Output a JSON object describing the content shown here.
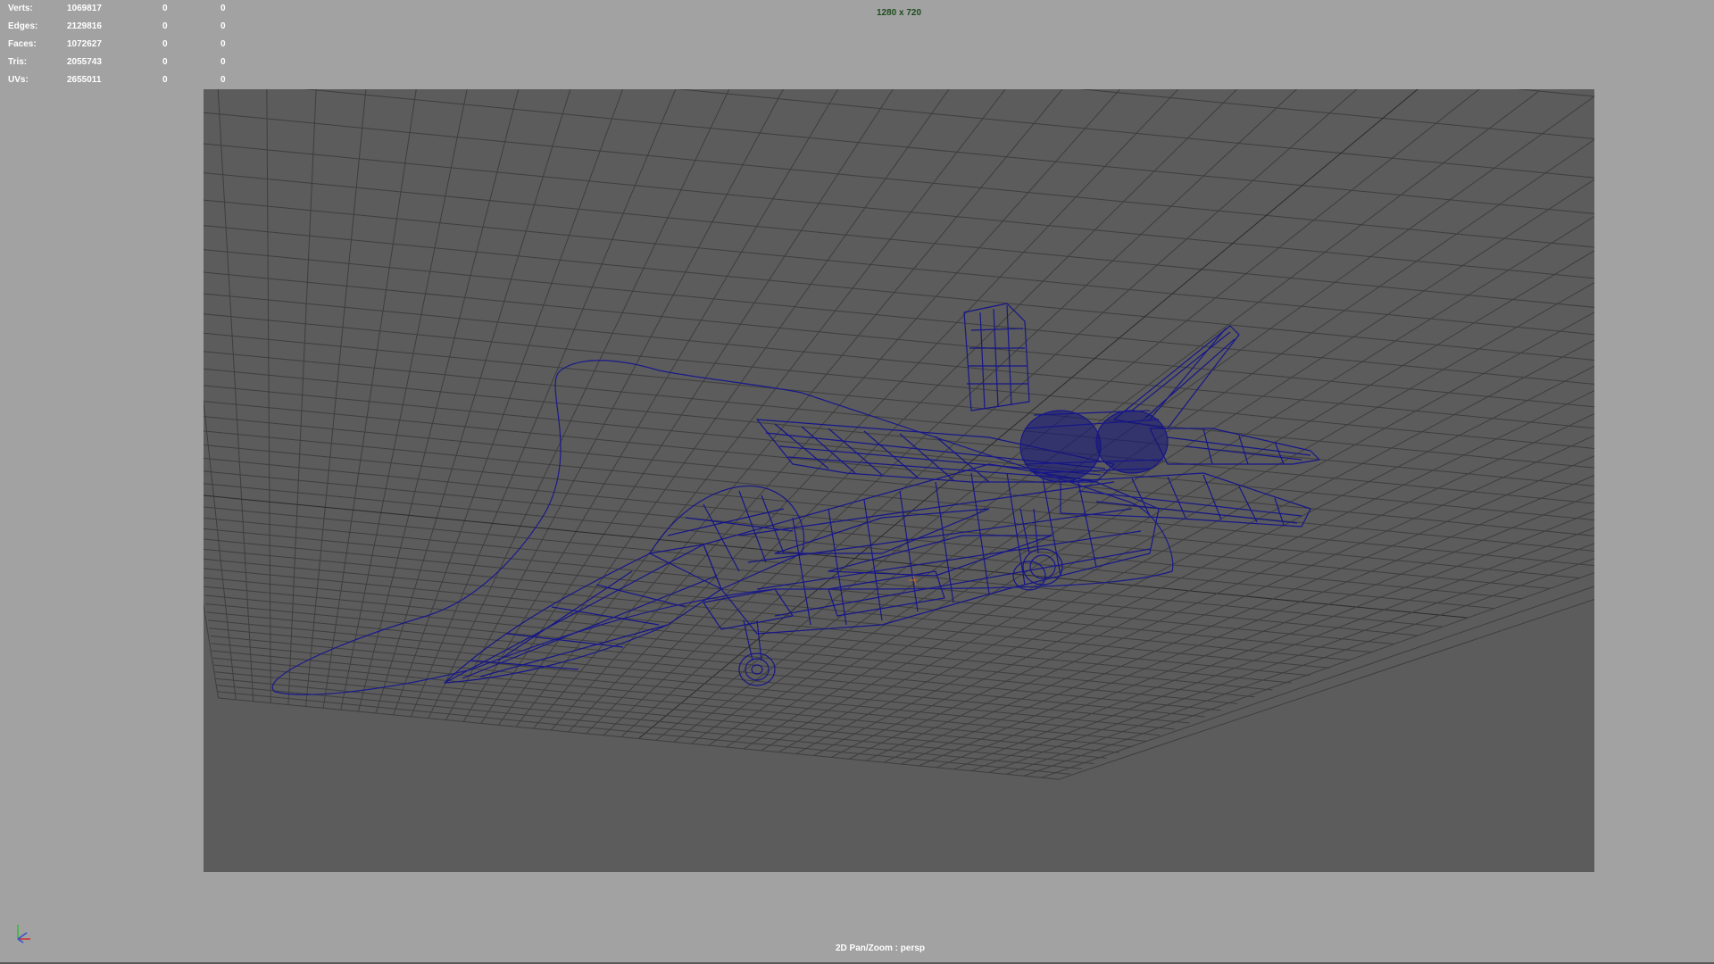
{
  "hud": {
    "rows": [
      {
        "label": "Verts:",
        "total": "1069817",
        "selected": "0",
        "component": "0"
      },
      {
        "label": "Edges:",
        "total": "2129816",
        "selected": "0",
        "component": "0"
      },
      {
        "label": "Faces:",
        "total": "1072627",
        "selected": "0",
        "component": "0"
      },
      {
        "label": "Tris:",
        "total": "2055743",
        "selected": "0",
        "component": "0"
      },
      {
        "label": "UVs:",
        "total": "2655011",
        "selected": "0",
        "component": "0"
      }
    ]
  },
  "viewport": {
    "resolution_label": "1280 x 720",
    "camera_label": "2D Pan/Zoom : persp",
    "background_color": "#a2a2a2",
    "gate_color": "#5c5c5c",
    "grid_color": "#3c3c3c",
    "wireframe_color": "#1a1a8c"
  },
  "axis_gizmo": {
    "icon": "axis-gizmo-icon",
    "x_color": "#d03030",
    "y_color": "#30c030",
    "z_color": "#3050d0"
  }
}
